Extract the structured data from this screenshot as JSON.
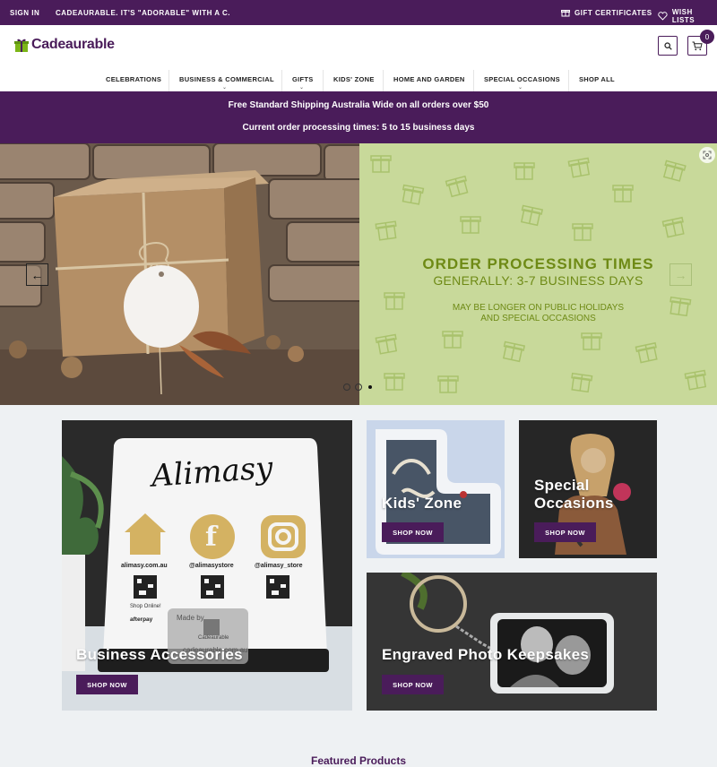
{
  "topbar": {
    "sign_in": "SIGN IN",
    "tagline": "CADEAURABLE. IT'S \"ADORABLE\" WITH A C.",
    "gift_certificates": "GIFT CERTIFICATES",
    "wish_lists": "WISH LISTS"
  },
  "header": {
    "logo_text": "Cadeaurable",
    "cart_count": "0"
  },
  "nav": {
    "items": [
      "CELEBRATIONS",
      "BUSINESS & COMMERCIAL",
      "GIFTS",
      "KIDS' ZONE",
      "HOME AND GARDEN",
      "SPECIAL OCCASIONS",
      "SHOP ALL"
    ]
  },
  "promo": {
    "line1": "Free Standard Shipping Australia Wide on all orders over $50",
    "line2": "Current order processing times: 5 to 15 business days"
  },
  "hero": {
    "title": "ORDER PROCESSING TIMES",
    "subtitle": "GENERALLY: 3-7 BUSINESS DAYS",
    "note_line1": "MAY BE LONGER ON PUBLIC HOLIDAYS",
    "note_line2": "AND SPECIAL OCCASIONS",
    "prev_arrow": "←",
    "next_arrow": "→"
  },
  "sign_panel": {
    "brand": "Alimasy",
    "site": "alimasy.com.au",
    "fb": "@alimasystore",
    "ig": "@alimasy_store",
    "shop_online": "Shop Online!",
    "afterpay": "afterpay",
    "made_by": "Made by",
    "made_brand": "Cadeaurable",
    "made_site": "cadeaurable.com.au"
  },
  "tiles": {
    "business": {
      "title": "Business Accessories",
      "button": "SHOP NOW"
    },
    "kids": {
      "title": "Kids' Zone",
      "button": "SHOP NOW"
    },
    "special": {
      "title_line1": "Special",
      "title_line2": "Occasions",
      "button": "SHOP NOW"
    },
    "engraved": {
      "title": "Engraved Photo Keepsakes",
      "button": "SHOP NOW"
    }
  },
  "featured": {
    "heading": "Featured Products"
  },
  "colors": {
    "brand": "#4a1c5a",
    "hero_green": "#c8d99a",
    "hero_text": "#6e8a15",
    "logo_green": "#7cb518"
  }
}
